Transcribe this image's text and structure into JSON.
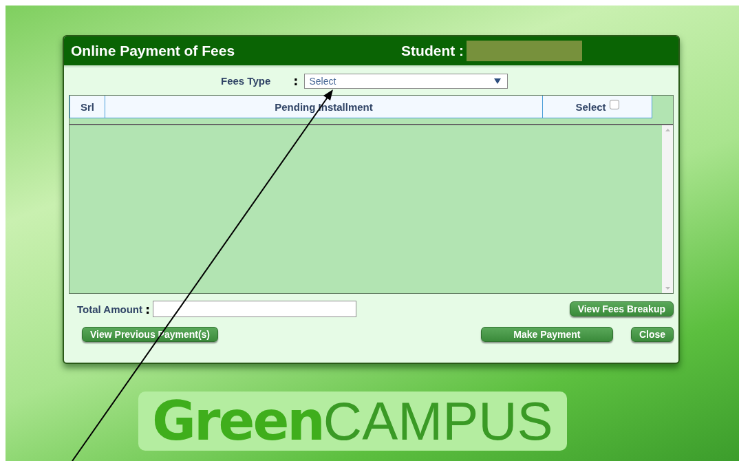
{
  "dialog": {
    "title": "Online Payment of Fees",
    "student_label": "Student :"
  },
  "fees_type": {
    "label": "Fees Type",
    "colon": ":",
    "value": "Select"
  },
  "table": {
    "columns": [
      "Srl",
      "Pending Installment",
      "Select"
    ],
    "select_all_checked": false
  },
  "total_amount": {
    "label": "Total Amount",
    "colon": ":"
  },
  "buttons": [
    {
      "label": "View Fees Breakup"
    },
    {
      "label": "View Previous Payment(s)"
    },
    {
      "label": "Make Payment"
    },
    {
      "label": "Close"
    }
  ],
  "logo": {
    "bold_part": "Green",
    "light_part": "CAMPUS"
  }
}
